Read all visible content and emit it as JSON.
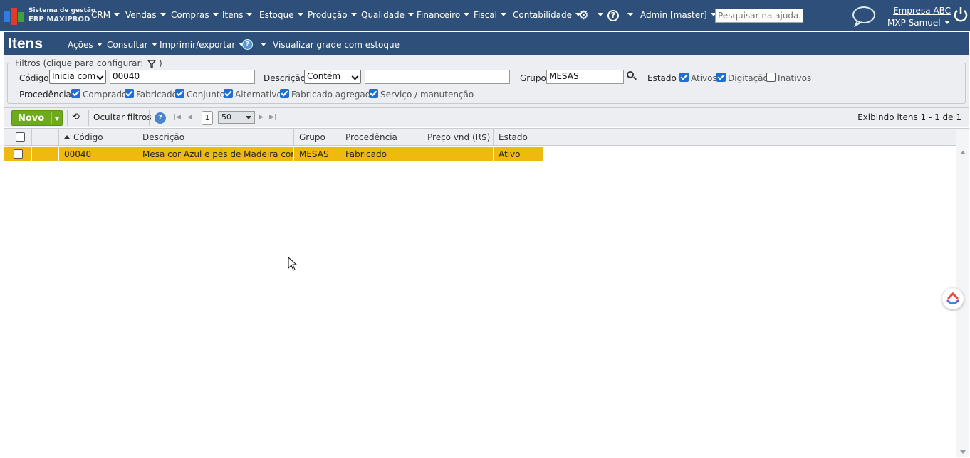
{
  "app": {
    "logo_line1": "Sistema de gestão",
    "logo_line2": "ERP MAXIPROD"
  },
  "topnav": {
    "menus": [
      "CRM",
      "Vendas",
      "Compras",
      "Itens",
      "Estoque",
      "Produção",
      "Qualidade",
      "Financeiro",
      "Fiscal",
      "Contabilidade"
    ],
    "admin": "Admin [master]",
    "search_placeholder": "Pesquisar na ajuda...",
    "company": "Empresa ABC",
    "user": "MXP Samuel"
  },
  "page": {
    "title": "Itens",
    "menus": [
      "Ações",
      "Consultar",
      "Imprimir/exportar"
    ],
    "grid_link": "Visualizar grade com estoque"
  },
  "filters": {
    "legend": "Filtros (clique para configurar:",
    "legend_close": ")",
    "codigo_label": "Código",
    "codigo_mode": "Inicia com",
    "codigo_value": "00040",
    "descricao_label": "Descrição",
    "descricao_mode": "Contém",
    "descricao_value": "",
    "grupo_label": "Grupo",
    "grupo_value": "MESAS",
    "estado_label": "Estado",
    "estado_options": [
      {
        "label": "Ativos",
        "checked": true
      },
      {
        "label": "Digitação",
        "checked": true
      },
      {
        "label": "Inativos",
        "checked": false
      }
    ],
    "procedencia_label": "Procedência",
    "procedencia_options": [
      {
        "label": "Comprado",
        "checked": true
      },
      {
        "label": "Fabricado",
        "checked": true
      },
      {
        "label": "Conjunto",
        "checked": true
      },
      {
        "label": "Alternativo",
        "checked": true
      },
      {
        "label": "Fabricado agregado",
        "checked": true
      },
      {
        "label": "Serviço / manutenção",
        "checked": true
      }
    ]
  },
  "toolbar": {
    "novo": "Novo",
    "ocultar": "Ocultar filtros",
    "page": "1",
    "page_size": "50",
    "exibindo": "Exibindo itens 1 - 1 de 1"
  },
  "grid": {
    "columns": [
      "Código",
      "Descrição",
      "Grupo",
      "Procedência",
      "Preço vnd (R$)",
      "Estado"
    ],
    "rows": [
      {
        "codigo": "00040",
        "descricao": "Mesa cor Azul e pés de Madeira com...",
        "grupo": "MESAS",
        "procedencia": "Fabricado",
        "preco": "",
        "estado": "Ativo"
      }
    ],
    "selected_row_color": "#f0b90f"
  },
  "colors": {
    "nav": "#2d4f79",
    "novo": "#6eab1a",
    "checkbox": "#1f6fd1"
  }
}
